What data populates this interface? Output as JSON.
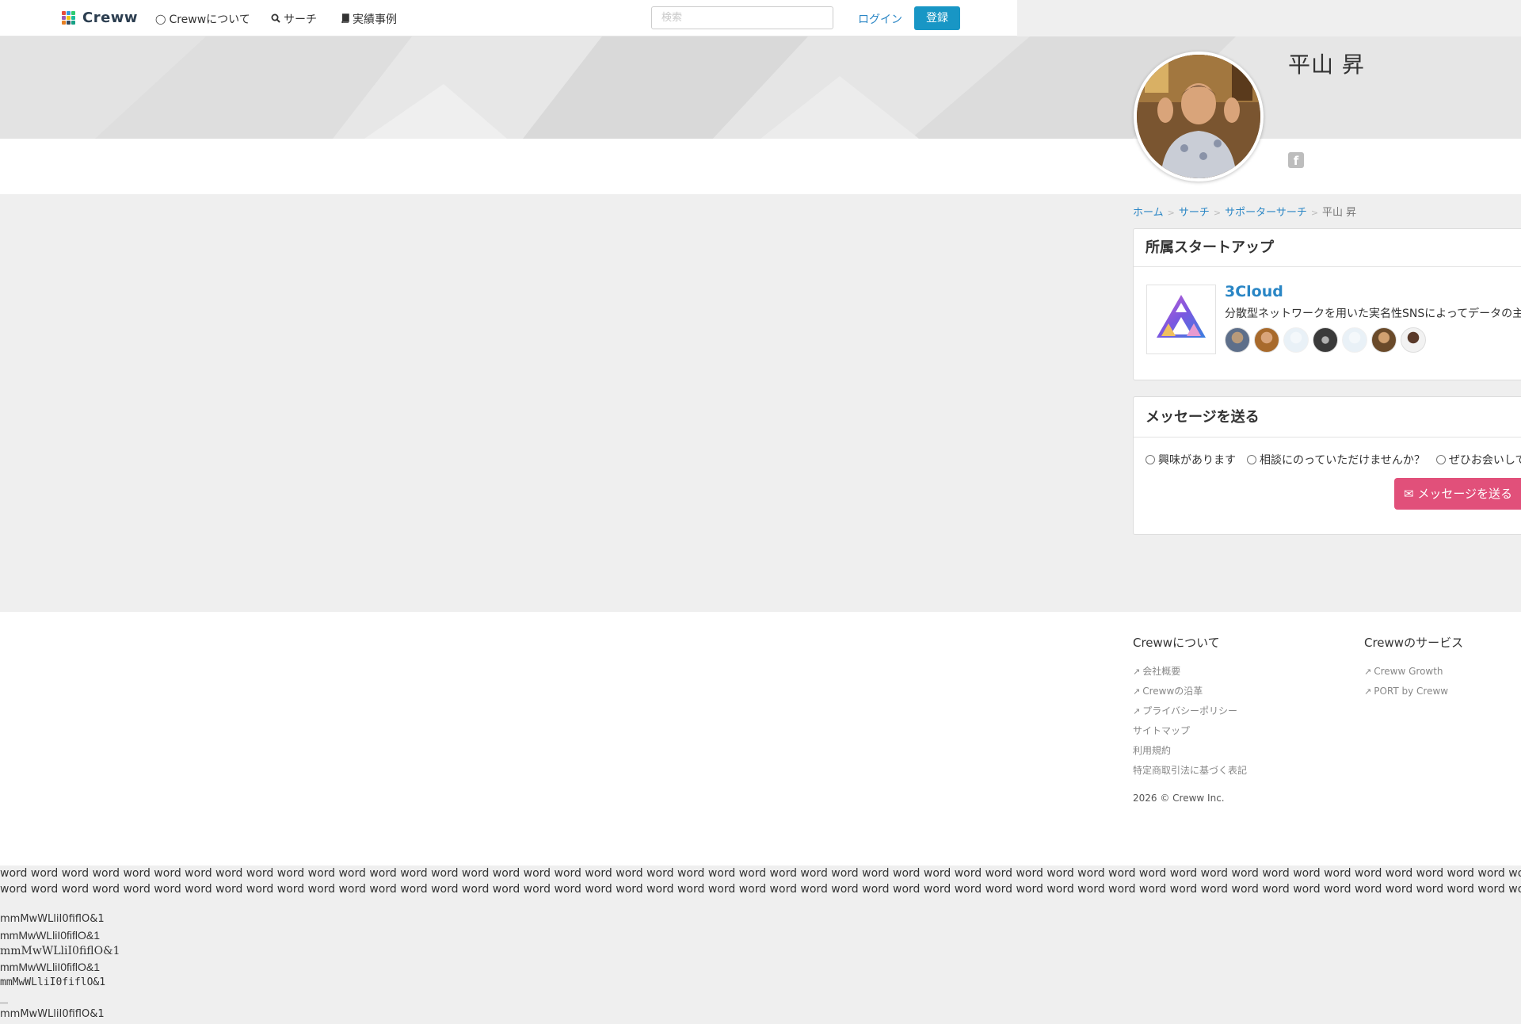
{
  "nav": {
    "brand": "Creww",
    "items": [
      {
        "label": "Crewwについて",
        "icon": "lightbulb-icon"
      },
      {
        "label": "サーチ",
        "icon": "search-icon"
      },
      {
        "label": "実績事例",
        "icon": "book-icon"
      }
    ],
    "search_placeholder": "検索",
    "login_label": "ログイン",
    "register_label": "登録"
  },
  "profile": {
    "name": "平山 昇",
    "social_icon": "facebook-icon"
  },
  "breadcrumb": {
    "items": [
      "ホーム",
      "サーチ",
      "サポーターサーチ"
    ],
    "current": "平山 昇",
    "separator": ">"
  },
  "startup_panel": {
    "title": "所属スタートアップ",
    "startup": {
      "name": "3Cloud",
      "description": "分散型ネットワークを用いた実名性SNSによってデータの主"
    },
    "member_count": 7
  },
  "message_panel": {
    "title": "メッセージを送る",
    "options": [
      "興味があります",
      "相談にのっていただけませんか？",
      "ぜひお会いして"
    ],
    "send_label": "メッセージを送る"
  },
  "footer": {
    "about": {
      "heading": "Crewwについて",
      "links": [
        {
          "label": "会社概要",
          "external": true
        },
        {
          "label": "Crewwの沿革",
          "external": true
        },
        {
          "label": "プライバシーポリシー",
          "external": true
        },
        {
          "label": "サイトマップ",
          "external": false
        },
        {
          "label": "利用規約",
          "external": false
        },
        {
          "label": "特定商取引法に基づく表記",
          "external": false
        }
      ]
    },
    "services": {
      "heading": "Crewwのサービス",
      "links": [
        {
          "label": "Creww Growth",
          "external": true
        },
        {
          "label": "PORT by Creww",
          "external": true
        }
      ]
    },
    "copyright": "2026 © Creww Inc."
  },
  "test_text": {
    "word_line": "word word word word word word word word word word word word word word word word word word word word word word word word word word word word word word word word word word word word word word word word word word word word word word word word word word word word word word word word word word word word word wor",
    "glyph_lines": [
      "mmMwWLliI0fiflO&1",
      "mmMwWLliI0fiflO&1",
      "mmMwWLliI0fiflO&1",
      "mmMwWLliI0fiflO&1",
      "mmMwWLliI0fiflO&1",
      "mmMwWLliI0fiflO&1"
    ]
  },
  "colors": {
    "link": "#2a86c5",
    "register_button": "#1896c5",
    "message_button": "#e1507a"
  }
}
